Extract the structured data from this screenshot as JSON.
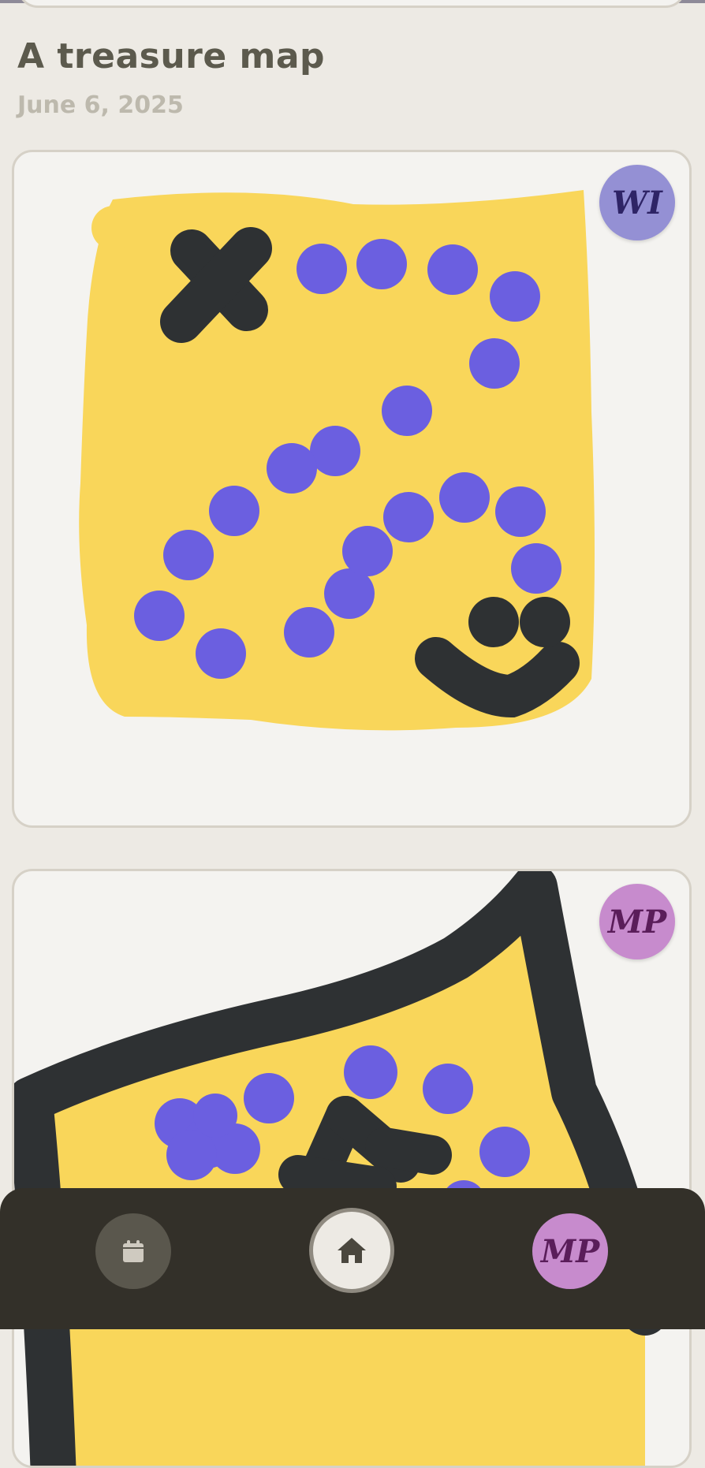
{
  "entry": {
    "title": "A treasure map",
    "date": "June 6, 2025"
  },
  "drawings": [
    {
      "author_initials": "WI",
      "author_color": "#9490d4",
      "subject": "treasure map with X and dotted trail"
    },
    {
      "author_initials": "MP",
      "author_color": "#c78bcd",
      "subject": "treasure map with X and dots"
    }
  ],
  "bottom_nav": {
    "calendar_icon": "calendar-icon",
    "home_icon": "home-icon",
    "profile_initials": "MP"
  },
  "colors": {
    "background": "#edeae4",
    "card": "#f4f3f0",
    "map_yellow": "#f9d65a",
    "dot_purple": "#6b5fe0",
    "ink": "#2e3133",
    "nav": "#333029"
  }
}
